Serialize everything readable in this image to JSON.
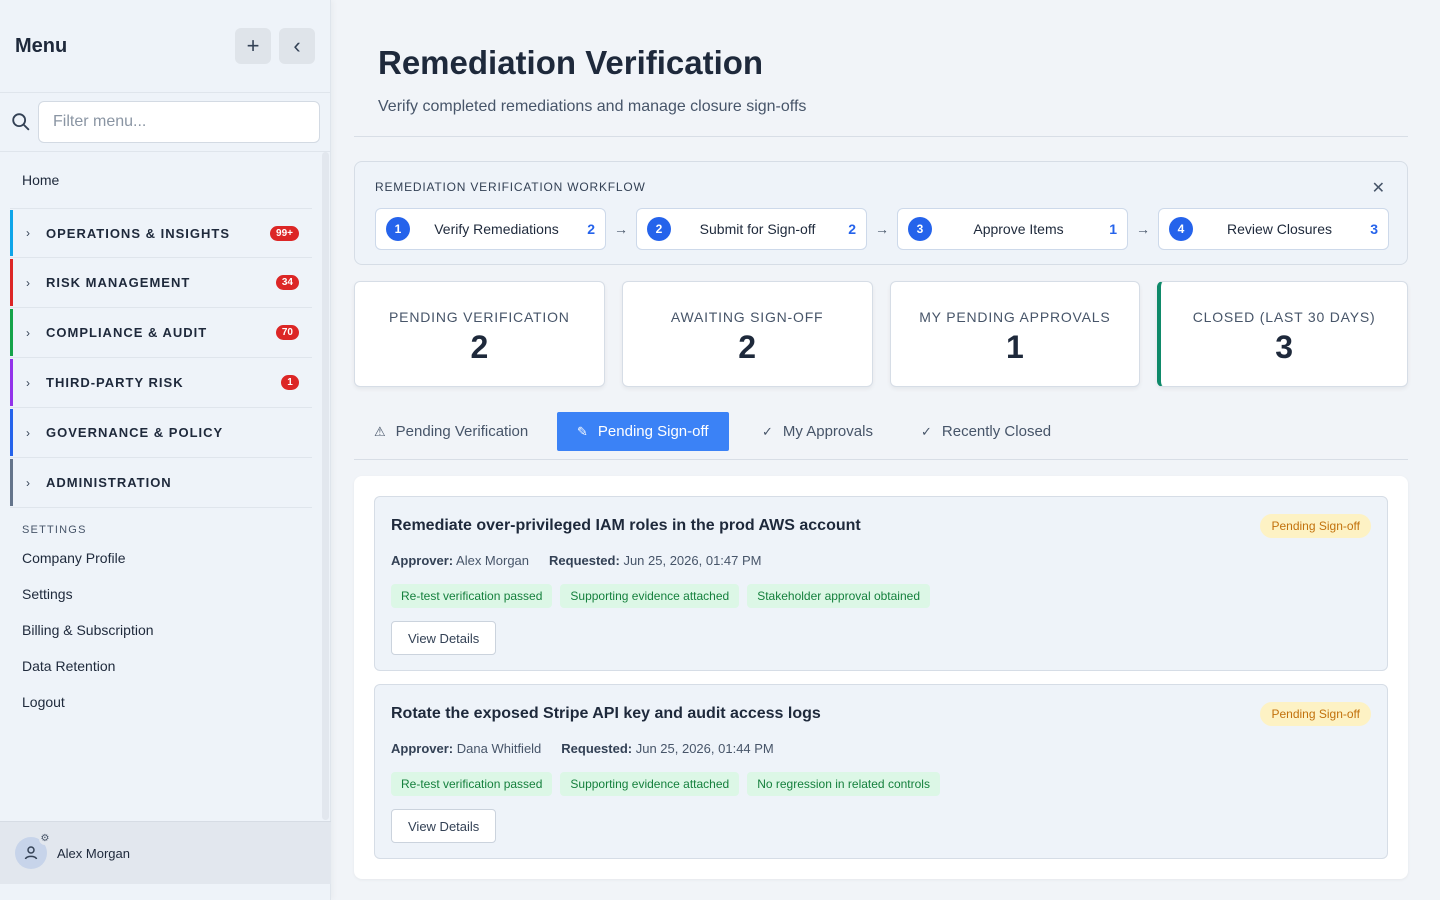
{
  "sidebar": {
    "title": "Menu",
    "add_label": "+",
    "collapse_label": "‹",
    "filter_placeholder": "Filter menu...",
    "home": "Home",
    "groups": [
      {
        "label": "OPERATIONS & INSIGHTS",
        "badge": "99+",
        "color": "#0ea5e9"
      },
      {
        "label": "RISK MANAGEMENT",
        "badge": "34",
        "color": "#dc2626"
      },
      {
        "label": "COMPLIANCE & AUDIT",
        "badge": "70",
        "color": "#16a34a"
      },
      {
        "label": "THIRD-PARTY RISK",
        "badge": "1",
        "color": "#9333ea"
      },
      {
        "label": "GOVERNANCE & POLICY",
        "badge": "",
        "color": "#2563eb"
      },
      {
        "label": "ADMINISTRATION",
        "badge": "",
        "color": "#64748b"
      }
    ],
    "settings_heading": "SETTINGS",
    "settings_links": [
      "Company Profile",
      "Settings",
      "Billing & Subscription",
      "Data Retention",
      "Logout"
    ],
    "user_name": "Alex Morgan"
  },
  "header": {
    "title": "Remediation Verification",
    "subtitle": "Verify completed remediations and manage closure sign-offs"
  },
  "workflow": {
    "title": "REMEDIATION VERIFICATION WORKFLOW",
    "close_label": "✕",
    "arrow": "→",
    "steps": [
      {
        "num": "1",
        "label": "Verify Remediations",
        "count": "2"
      },
      {
        "num": "2",
        "label": "Submit for Sign-off",
        "count": "2"
      },
      {
        "num": "3",
        "label": "Approve Items",
        "count": "1"
      },
      {
        "num": "4",
        "label": "Review Closures",
        "count": "3"
      }
    ]
  },
  "stats": [
    {
      "label": "PENDING VERIFICATION",
      "value": "2"
    },
    {
      "label": "AWAITING SIGN-OFF",
      "value": "2"
    },
    {
      "label": "MY PENDING APPROVALS",
      "value": "1"
    },
    {
      "label": "CLOSED (LAST 30 DAYS)",
      "value": "3"
    }
  ],
  "tabs": [
    {
      "icon": "⚠",
      "label": "Pending Verification"
    },
    {
      "icon": "✎",
      "label": "Pending Sign-off"
    },
    {
      "icon": "✓",
      "label": "My Approvals"
    },
    {
      "icon": "✓",
      "label": "Recently Closed"
    }
  ],
  "cards": [
    {
      "title": "Remediate over-privileged IAM roles in the prod AWS account",
      "status": "Pending Sign-off",
      "approver_label": "Approver:",
      "approver": "Alex Morgan",
      "requested_label": "Requested:",
      "requested": "Jun 25, 2026, 01:47 PM",
      "tags": [
        "Re-test verification passed",
        "Supporting evidence attached",
        "Stakeholder approval obtained"
      ],
      "button": "View Details"
    },
    {
      "title": "Rotate the exposed Stripe API key and audit access logs",
      "status": "Pending Sign-off",
      "approver_label": "Approver:",
      "approver": "Dana Whitfield",
      "requested_label": "Requested:",
      "requested": "Jun 25, 2026, 01:44 PM",
      "tags": [
        "Re-test verification passed",
        "Supporting evidence attached",
        "No regression in related controls"
      ],
      "button": "View Details"
    }
  ]
}
